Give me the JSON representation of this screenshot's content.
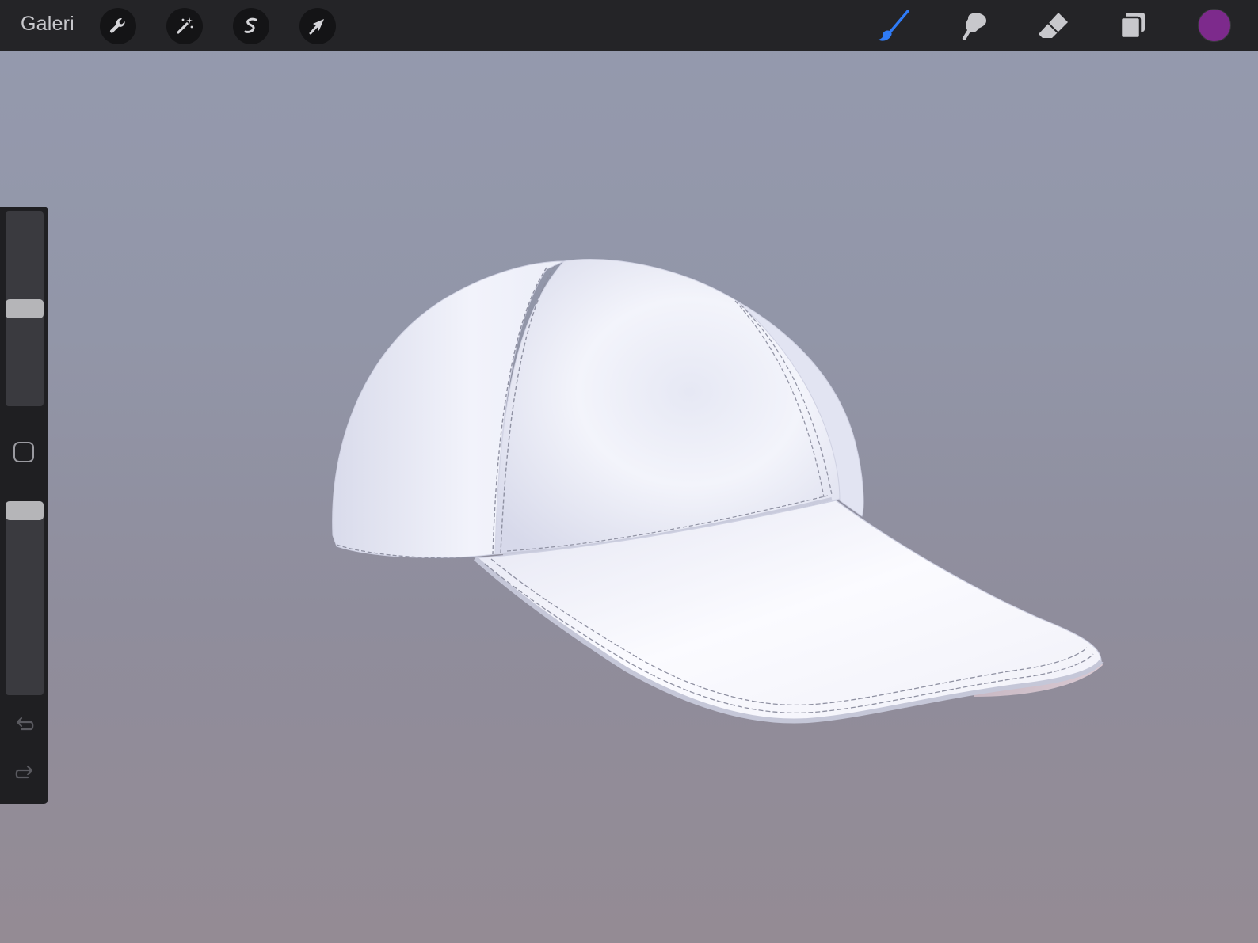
{
  "topbar": {
    "gallery_label": "Galeri",
    "actions": [
      "wrench-icon",
      "magic-wand-icon",
      "selection-icon",
      "transform-arrow-icon"
    ],
    "tools": [
      "brush-icon",
      "smudge-icon",
      "eraser-icon",
      "layers-icon"
    ],
    "active_tool": "brush-icon",
    "active_color": "#7d2a8c",
    "brush_active_color": "#2f7bf6"
  },
  "sidebar": {
    "brush_size_slider": "size",
    "opacity_slider": "opacity",
    "modify_button": "modify",
    "undo": "undo-icon",
    "redo": "redo-icon"
  },
  "canvas": {
    "subject": "baseball-cap-3d-model",
    "cap_color": "#eef0fa"
  }
}
